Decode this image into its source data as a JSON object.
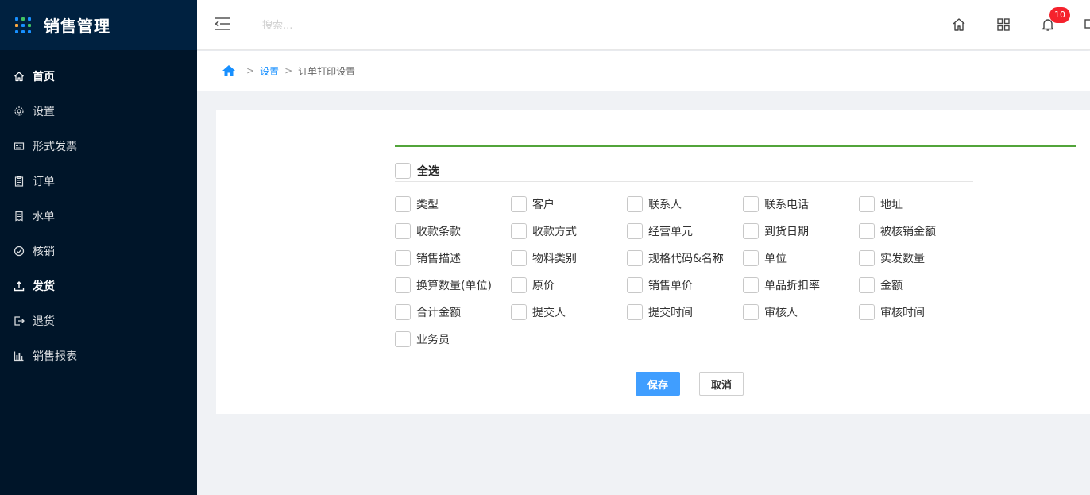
{
  "brand": {
    "title": "销售管理"
  },
  "sidebar": {
    "items": [
      {
        "label": "首页",
        "icon": "home-icon",
        "bold": true
      },
      {
        "label": "设置",
        "icon": "gear-icon",
        "bold": false
      },
      {
        "label": "形式发票",
        "icon": "invoice-icon",
        "bold": false
      },
      {
        "label": "订单",
        "icon": "clipboard-icon",
        "bold": false
      },
      {
        "label": "水单",
        "icon": "receipt-icon",
        "bold": false
      },
      {
        "label": "核销",
        "icon": "check-circle-icon",
        "bold": false
      },
      {
        "label": "发货",
        "icon": "upload-icon",
        "bold": true
      },
      {
        "label": "退货",
        "icon": "logout-icon",
        "bold": false
      },
      {
        "label": "销售报表",
        "icon": "bar-chart-icon",
        "bold": false
      }
    ]
  },
  "header": {
    "search_placeholder": "搜索...",
    "notification_count": "10",
    "icons": [
      "menu-collapse-icon",
      "home-icon",
      "grid-icon",
      "bell-icon",
      "screen-icon"
    ]
  },
  "breadcrumb": {
    "separator": ">",
    "items": [
      "设置",
      "订单打印设置"
    ]
  },
  "form": {
    "select_all_label": "全选",
    "fields": [
      [
        "类型",
        "客户",
        "联系人",
        "联系电话",
        "地址"
      ],
      [
        "收款条款",
        "收款方式",
        "经营单元",
        "到货日期",
        "被核销金额"
      ],
      [
        "销售描述",
        "物料类别",
        "规格代码&名称",
        "单位",
        "实发数量"
      ],
      [
        "换算数量(单位)",
        "原价",
        "销售单价",
        "单品折扣率",
        "金额"
      ],
      [
        "合计金额",
        "提交人",
        "提交时间",
        "审核人",
        "审核时间"
      ],
      [
        "业务员"
      ]
    ],
    "save_label": "保存",
    "cancel_label": "取消"
  },
  "colors": {
    "sidebar_bg": "#001529",
    "accent": "#409eff",
    "divider_green": "#52a43a",
    "badge": "#f5222d"
  }
}
